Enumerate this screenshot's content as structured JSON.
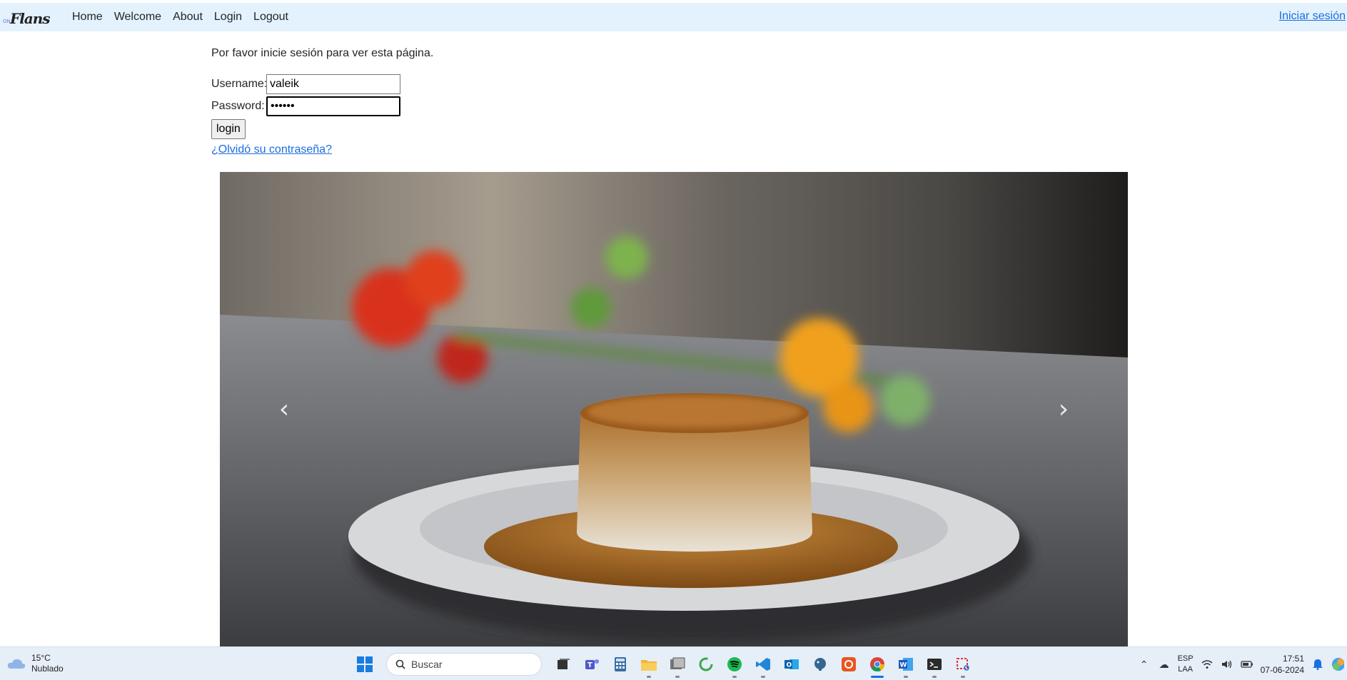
{
  "navbar": {
    "brand_small": "ON",
    "brand_big": "Flans",
    "links": [
      "Home",
      "Welcome",
      "About",
      "Login",
      "Logout"
    ],
    "right_link": "Iniciar sesión"
  },
  "login": {
    "message": "Por favor inicie sesión para ver esta página.",
    "username_label": "Username:",
    "username_value": "valeik",
    "password_label": "Password:",
    "password_value": "••••••",
    "button_label": "login",
    "forgot_link": "¿Olvidó su contraseña?"
  },
  "carousel": {
    "prev_symbol": "‹",
    "next_symbol": "›"
  },
  "taskbar": {
    "weather_temp": "15°C",
    "weather_desc": "Nublado",
    "search_placeholder": "Buscar",
    "lang_top": "ESP",
    "lang_bottom": "LAA",
    "time": "17:51",
    "date": "07-06-2024"
  },
  "colors": {
    "navbar_bg": "#e3f2fd",
    "link": "#1a6ee0",
    "taskbar_bg": "#e6eef8"
  }
}
